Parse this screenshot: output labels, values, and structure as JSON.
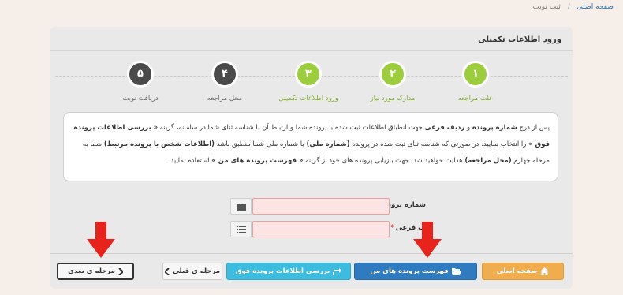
{
  "breadcrumb": {
    "home": "صفحه اصلی",
    "separator": "/",
    "current": "ثبت نوبت"
  },
  "panel": {
    "title": "ورود اطلاعات تکمیلی"
  },
  "steps": [
    {
      "number": "۱",
      "label": "علت مراجعه",
      "state": "done"
    },
    {
      "number": "۲",
      "label": "مدارک مورد نیاز",
      "state": "done"
    },
    {
      "number": "۳",
      "label": "ورود اطلاعات تکمیلی",
      "state": "done"
    },
    {
      "number": "۴",
      "label": "محل مراجعه",
      "state": "todo"
    },
    {
      "number": "۵",
      "label": "دریافت نوبت",
      "state": "todo"
    }
  ],
  "info": {
    "p1": "پس از درج ",
    "b1": "شماره پرونده",
    "p2": " و ",
    "b2": "ردیف فرعی",
    "p3": " جهت انطباق اطلاعات ثبت شده با پرونده شما و ارتباط آن با شناسه ثنای شما در سامانه، گزینه ",
    "b3": "« بررسی اطلاعات پرونده فوق »",
    "p4": " را انتخاب نمایید. در صورتی که شناسه ثنای ثبت شده در پرونده ",
    "b4": "(شماره ملی)",
    "p5": " با شماره ملی شما منطبق باشد ",
    "b5": "(اطلاعات شخص با پرونده مرتبط)",
    "p6": " شما به مرحله چهارم ",
    "b6": "(محل مراجعه)",
    "p7": " هدایت خواهید شد. جهت بازیابی پرونده های خود از گزینه ",
    "b7": "« فهرست پرونده های من »",
    "p8": " استفاده نمایید."
  },
  "form": {
    "case_number": {
      "label": "شماره پرونده",
      "required_mark": "*",
      "value": ""
    },
    "sub_row": {
      "label": "ف فرعی",
      "required_mark": "*",
      "value": ""
    }
  },
  "buttons": {
    "home": "صفحه اصلی",
    "my_files": "فهرست پرونده های من",
    "review": "بررسی اطلاعات پرونده فوق",
    "prev": "مرحله ی قبلی",
    "next": "مرحله ی بعدی"
  },
  "icons": {
    "home": "home-icon",
    "my_files": "folder-open-icon",
    "review": "refresh-icon",
    "prev": "chevron-left-icon",
    "next": "chevron-right-icon",
    "case_number": "folder-icon",
    "sub_row": "list-icon",
    "annotation": "red-down-arrow-icon"
  },
  "colors": {
    "step_done": "#9ccd3c",
    "step_todo": "#4a4a4a",
    "home_button": "#f0ad4e",
    "my_files_button": "#2f7bbf",
    "review_button": "#3cbde0",
    "annotation_arrow": "#e8231b"
  }
}
